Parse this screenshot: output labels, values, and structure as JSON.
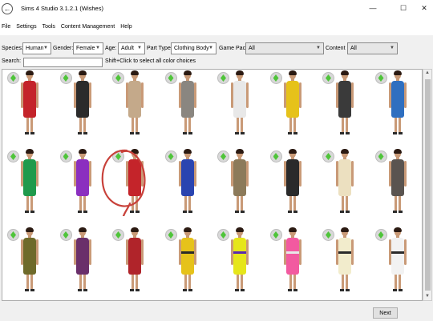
{
  "window": {
    "title": "Sims 4 Studio 3.1.2.1 (Wishes)",
    "minimize": "—",
    "maximize": "☐",
    "close": "✕"
  },
  "menu": [
    "File",
    "Settings",
    "Tools",
    "Content Management",
    "Help"
  ],
  "filters": {
    "species_label": "Species:",
    "species_value": "Human",
    "gender_label": "Gender:",
    "gender_value": "Female",
    "age_label": "Age:",
    "age_value": "Adult",
    "parttype_label": "Part Type:",
    "parttype_value": "Clothing Body",
    "gamepack_label": "Game Pack",
    "gamepack_value": "All",
    "content_label": "Content",
    "content_value": "All"
  },
  "search": {
    "label": "Search:",
    "value": "",
    "hint": "Shift+Click to select all color choices"
  },
  "swatches": [
    {
      "color": "#c4242a",
      "accent": ""
    },
    {
      "color": "#2b2b2b",
      "accent": ""
    },
    {
      "color": "#c4a98a",
      "accent": ""
    },
    {
      "color": "#8a8680",
      "accent": ""
    },
    {
      "color": "#e8e8e8",
      "accent": ""
    },
    {
      "color": "#e6c21a",
      "accent": ""
    },
    {
      "color": "#3a3a3a",
      "accent": ""
    },
    {
      "color": "#2f6fc0",
      "accent": ""
    },
    {
      "color": "#1f9a4c",
      "accent": ""
    },
    {
      "color": "#8b2fbf",
      "accent": ""
    },
    {
      "color": "#c4242a",
      "accent": "",
      "selected": true
    },
    {
      "color": "#2a44b0",
      "accent": ""
    },
    {
      "color": "#8c7a5a",
      "accent": ""
    },
    {
      "color": "#2a2a2a",
      "accent": ""
    },
    {
      "color": "#ece0c0",
      "accent": ""
    },
    {
      "color": "#5a5450",
      "accent": ""
    },
    {
      "color": "#6e6a2a",
      "accent": ""
    },
    {
      "color": "#6a2f6a",
      "accent": ""
    },
    {
      "color": "#b0242a",
      "accent": ""
    },
    {
      "color": "#e6c21a",
      "accent": "#2a2a2a"
    },
    {
      "color": "#e6e61a",
      "accent": "#5a2ab0"
    },
    {
      "color": "#f25aa0",
      "accent": "#e8e8e8"
    },
    {
      "color": "#f2eccc",
      "accent": "#2a2a2a"
    },
    {
      "color": "#f2f2f2",
      "accent": "#2a2a2a"
    }
  ],
  "next_label": "Next",
  "colors": {
    "annotation": "#c8413a",
    "plumbob": "#4fc43a"
  }
}
